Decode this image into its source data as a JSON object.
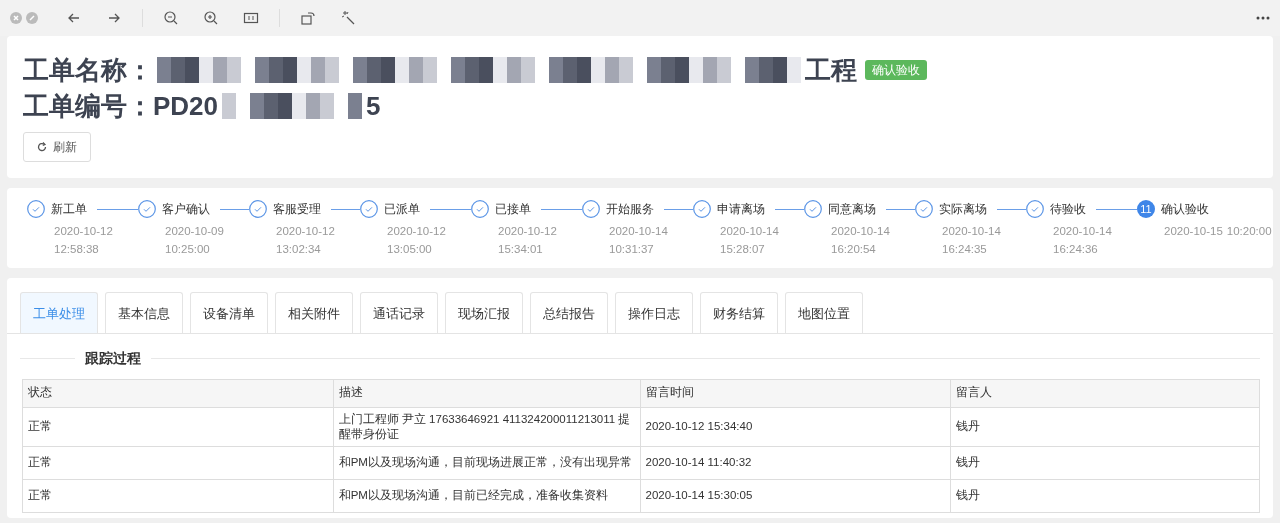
{
  "toolbar": {
    "buttons": [
      {
        "kind": "back"
      },
      {
        "kind": "forward"
      },
      {
        "kind": "sep"
      },
      {
        "kind": "zoom-out"
      },
      {
        "kind": "zoom-in"
      },
      {
        "kind": "fit"
      },
      {
        "kind": "sep"
      },
      {
        "kind": "rotate"
      },
      {
        "kind": "wand"
      }
    ]
  },
  "header": {
    "name_label": "工单名称：",
    "name_tail": "工程",
    "status_badge": "确认验收",
    "number_label": "工单编号：",
    "number_head": "PD20",
    "number_tail": "5",
    "refresh_button": "刷新"
  },
  "steps": [
    {
      "title": "新工单",
      "date": "2020-10-12",
      "time": "12:58:38",
      "completed": true
    },
    {
      "title": "客户确认",
      "date": "2020-10-09",
      "time": "10:25:00",
      "completed": true
    },
    {
      "title": "客服受理",
      "date": "2020-10-12",
      "time": "13:02:34",
      "completed": true
    },
    {
      "title": "已派单",
      "date": "2020-10-12",
      "time": "13:05:00",
      "completed": true
    },
    {
      "title": "已接单",
      "date": "2020-10-12",
      "time": "15:34:01",
      "completed": true
    },
    {
      "title": "开始服务",
      "date": "2020-10-14",
      "time": "10:31:37",
      "completed": true
    },
    {
      "title": "申请离场",
      "date": "2020-10-14",
      "time": "15:28:07",
      "completed": true
    },
    {
      "title": "同意离场",
      "date": "2020-10-14",
      "time": "16:20:54",
      "completed": true
    },
    {
      "title": "实际离场",
      "date": "2020-10-14",
      "time": "16:24:35",
      "completed": true
    },
    {
      "title": "待验收",
      "date": "2020-10-14",
      "time": "16:24:36",
      "completed": true
    },
    {
      "title": "确认验收",
      "number": "11",
      "date": "2020-10-15",
      "time": "10:20:00",
      "completed": false
    }
  ],
  "tabs": [
    {
      "label": "工单处理",
      "selected": true
    },
    {
      "label": "基本信息",
      "selected": false
    },
    {
      "label": "设备清单",
      "selected": false
    },
    {
      "label": "相关附件",
      "selected": false
    },
    {
      "label": "通话记录",
      "selected": false
    },
    {
      "label": "现场汇报",
      "selected": false
    },
    {
      "label": "总结报告",
      "selected": false
    },
    {
      "label": "操作日志",
      "selected": false
    },
    {
      "label": "财务结算",
      "selected": false
    },
    {
      "label": "地图位置",
      "selected": false
    }
  ],
  "section_title": "跟踪过程",
  "table": {
    "columns": [
      "状态",
      "描述",
      "留言时间",
      "留言人"
    ],
    "rows": [
      [
        "正常",
        "上门工程师 尹立 17633646921 411324200011213011 提醒带身份证",
        "2020-10-12 15:34:40",
        "钱丹"
      ],
      [
        "正常",
        "和PM以及现场沟通，目前现场进展正常，没有出现异常",
        "2020-10-14 11:40:32",
        "钱丹"
      ],
      [
        "正常",
        "和PM以及现场沟通，目前已经完成，准备收集资料",
        "2020-10-14 15:30:05",
        "钱丹"
      ]
    ]
  }
}
